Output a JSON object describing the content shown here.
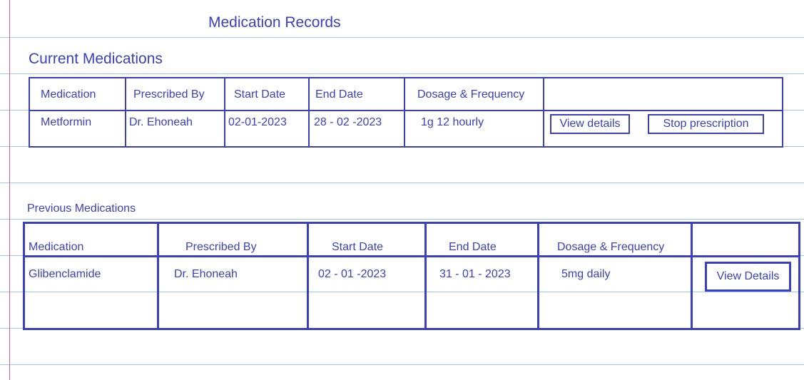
{
  "page": {
    "title": "Medication Records"
  },
  "current": {
    "section_title": "Current Medications",
    "headers": [
      "Medication",
      "Prescribed By",
      "Start Date",
      "End Date",
      "Dosage & Frequency"
    ],
    "rows": [
      {
        "medication": "Metformin",
        "prescribed_by": "Dr. Ehoneah",
        "start_date": "02-01-2023",
        "end_date": "28 - 02 -2023",
        "dosage": "1g 12 hourly",
        "view_label": "View details",
        "stop_label": "Stop prescription"
      }
    ]
  },
  "previous": {
    "section_title": "Previous Medications",
    "headers": [
      "Medication",
      "Prescribed By",
      "Start Date",
      "End Date",
      "Dosage & Frequency"
    ],
    "rows": [
      {
        "medication": "Glibenclamide",
        "prescribed_by": "Dr. Ehoneah",
        "start_date": "02 - 01 -2023",
        "end_date": "31 - 01 - 2023",
        "dosage": "5mg daily",
        "view_label": "View Details"
      }
    ]
  },
  "colors": {
    "ink": "#3a3fc4",
    "ruled_line": "#9ec9ef",
    "margin_line": "#e05a8c"
  }
}
